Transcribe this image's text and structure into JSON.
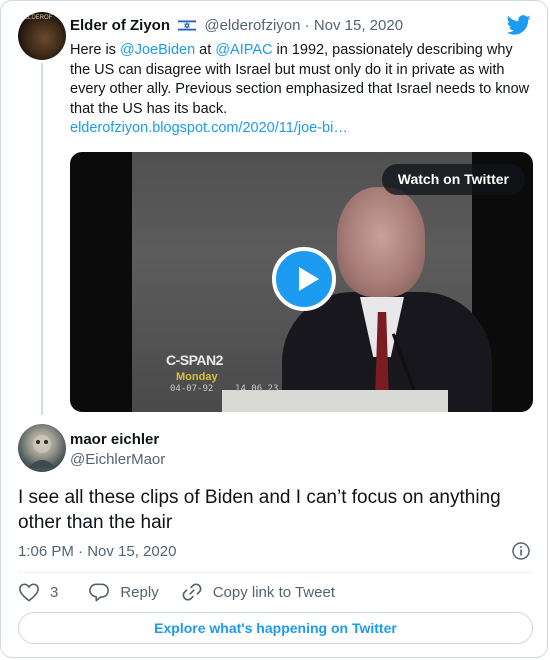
{
  "quoted_tweet": {
    "author_name": "Elder of Ziyon",
    "author_handle": "@elderofziyon",
    "separator": "·",
    "date": "Nov 15, 2020",
    "avatar_text": "ELDEROF",
    "text_parts": {
      "t1": "Here is ",
      "mention_1": "@JoeBiden",
      "t2": " at ",
      "mention_2": "@AIPAC",
      "t3": " in 1992, passionately describing why the US can disagree with Israel but must only do it in private as with every other ally. Previous section emphasized that Israel needs to know that the US has its back."
    },
    "link": "elderofziyon.blogspot.com/2020/11/joe-bi…",
    "video": {
      "watch_label": "Watch on Twitter",
      "overlay_network": "C-SPAN2",
      "overlay_day": "Monday",
      "overlay_timestamp": "04-07-92    14 06 23"
    }
  },
  "reply": {
    "author_name": "maor eichler",
    "author_handle": "@EichlerMaor",
    "text": "I see all these clips of Biden and I can’t focus on anything other than the hair",
    "timestamp": "1:06 PM · Nov 15, 2020"
  },
  "actions": {
    "like_count": "3",
    "reply_label": "Reply",
    "copy_label": "Copy link to Tweet"
  },
  "explore_label": "Explore what's happening on Twitter",
  "colors": {
    "accent": "#1d9bf0",
    "text": "#0f1419",
    "muted": "#536471",
    "border": "#cfd9de"
  },
  "icons": [
    "twitter-bird-icon",
    "israel-flag-icon",
    "play-icon",
    "info-icon",
    "heart-icon",
    "reply-icon",
    "link-icon"
  ]
}
